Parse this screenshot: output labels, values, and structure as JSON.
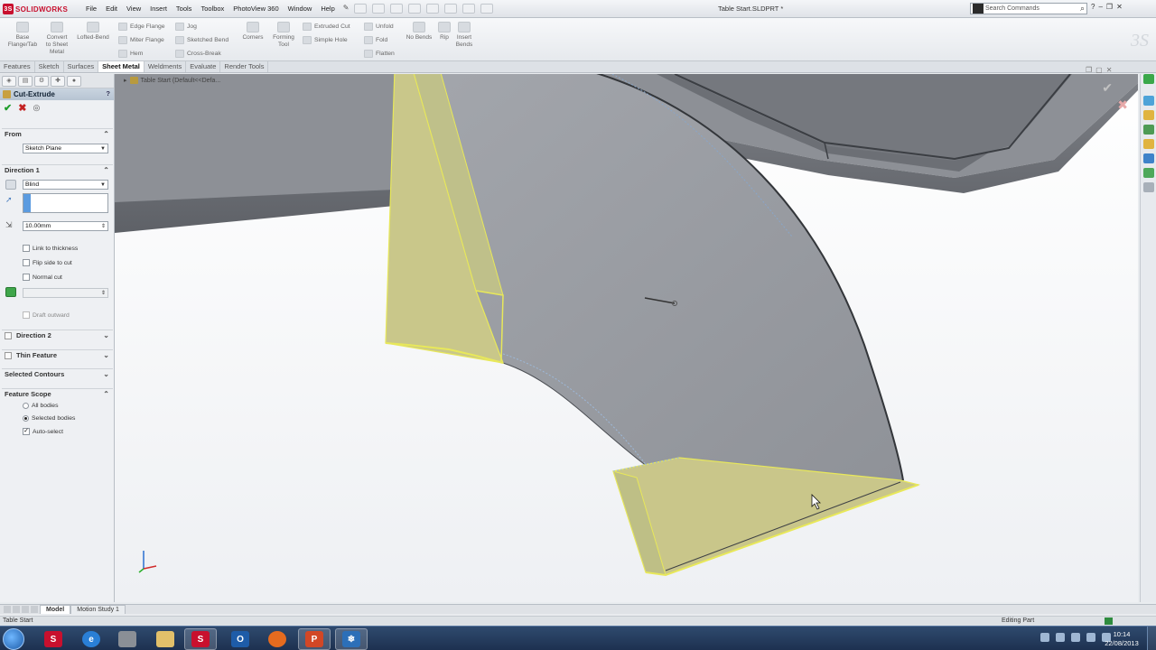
{
  "app": {
    "brand": "SOLIDWORKS",
    "document_title": "Table Start.SLDPRT *",
    "menu": [
      "File",
      "Edit",
      "View",
      "Insert",
      "Tools",
      "Toolbox",
      "PhotoView 360",
      "Window",
      "Help"
    ],
    "search_placeholder": "Search Commands",
    "help_label": "?"
  },
  "ribbon": {
    "base_flange": "Base\nFlange/Tab",
    "convert": "Convert\nto Sheet\nMetal",
    "lofted_bend": "Lofted-Bend",
    "edge_flange": "Edge Flange",
    "miter_flange": "Miter Flange",
    "hem": "Hem",
    "jog": "Jog",
    "sketched_bend": "Sketched Bend",
    "cross_break": "Cross-Break",
    "corners": "Corners",
    "forming_tool": "Forming\nTool",
    "extruded_cut": "Extruded Cut",
    "simple_hole": "Simple Hole",
    "unfold": "Unfold",
    "fold": "Fold",
    "flatten": "Flatten",
    "no_bends": "No Bends",
    "rip": "Rip",
    "insert_bends": "Insert\nBends"
  },
  "tabs": [
    "Features",
    "Sketch",
    "Surfaces",
    "Sheet Metal",
    "Weldments",
    "Evaluate",
    "Render Tools"
  ],
  "active_tab": "Sheet Metal",
  "panel": {
    "feature_name": "Cut-Extrude",
    "help": "?",
    "from": {
      "header": "From",
      "value": "Sketch Plane"
    },
    "direction1": {
      "header": "Direction 1",
      "end_condition": "Blind",
      "depth": "10.00mm",
      "link_to_thickness": "Link to thickness",
      "flip_side": "Flip side to cut",
      "normal_cut": "Normal cut",
      "draft_outward": "Draft outward"
    },
    "direction2": "Direction 2",
    "thin_feature": "Thin Feature",
    "selected_contours": "Selected Contours",
    "feature_scope": {
      "header": "Feature Scope",
      "all_bodies": "All bodies",
      "selected_bodies": "Selected bodies",
      "auto_select": "Auto-select"
    }
  },
  "viewport": {
    "tree_label": "Table Start  (Default<<Defa..."
  },
  "bottom_tabs": [
    "Model",
    "Motion Study 1"
  ],
  "status": {
    "left": "Table Start",
    "right": "Editing Part"
  },
  "taskbar": {
    "time": "10:14",
    "date": "22/08/2013"
  },
  "colors": {
    "accent_red": "#c8102e",
    "face_grey": "#9c9fa5",
    "highlight_yellow": "#e8e85a",
    "ok_green": "#1f9d2b",
    "cancel_red": "#c42222"
  }
}
